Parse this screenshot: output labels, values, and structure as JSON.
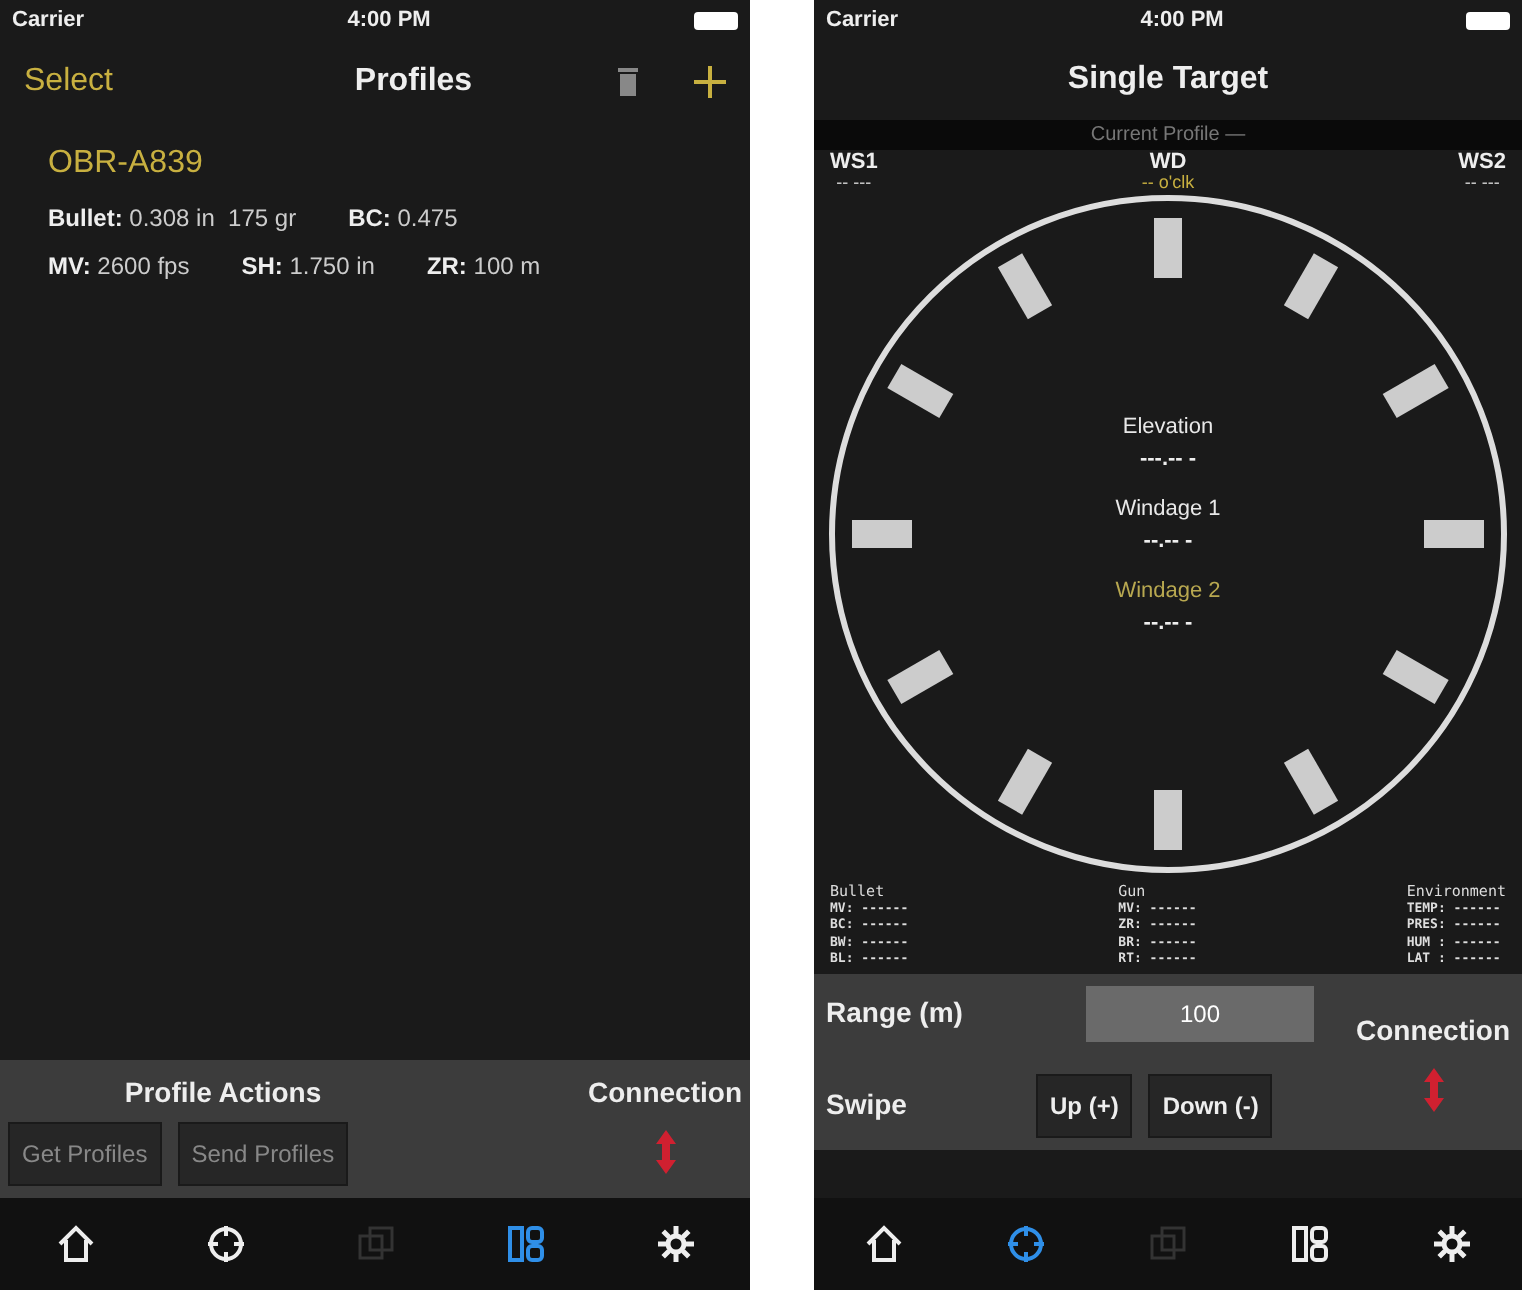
{
  "profiles_screen": {
    "status_bar": {
      "carrier": "Carrier",
      "time": "4:00 PM"
    },
    "nav": {
      "left": "Select",
      "title": "Profiles"
    },
    "profiles": [
      {
        "name": "OBR-A839",
        "rows": [
          [
            {
              "label": "Bullet:",
              "value": "0.308 in  175 gr"
            },
            {
              "label": "BC:",
              "value": "0.475"
            }
          ],
          [
            {
              "label": "MV:",
              "value": "2600 fps"
            },
            {
              "label": "SH:",
              "value": "1.750 in"
            },
            {
              "label": "ZR:",
              "value": "100 m"
            }
          ]
        ]
      }
    ],
    "actions_title": "Profile Actions",
    "connection_label": "Connection",
    "buttons": [
      {
        "label": "Get Profiles",
        "disabled": true
      },
      {
        "label": "Send Profiles",
        "disabled": true
      }
    ],
    "tabs": [
      {
        "kind": "home",
        "selected": false,
        "disabled": false
      },
      {
        "kind": "target",
        "selected": false,
        "disabled": false
      },
      {
        "kind": "window",
        "selected": false,
        "disabled": true
      },
      {
        "kind": "grid",
        "selected": true,
        "disabled": false
      },
      {
        "kind": "gear",
        "selected": false,
        "disabled": false
      }
    ]
  },
  "single_target_screen": {
    "status_bar": {
      "carrier": "Carrier",
      "time": "4:00 PM"
    },
    "title": "Single Target",
    "current_profile": "Current Profile —",
    "winds": [
      {
        "label": "WS1",
        "value": "-- ---",
        "color": "#d0d0d0"
      },
      {
        "label": "WD",
        "value": "-- o'clk",
        "color": "#c8b040"
      },
      {
        "label": "WS2",
        "value": "-- ---",
        "color": "#d0d0d0"
      }
    ],
    "readouts": [
      {
        "label": "Elevation",
        "value": "---.-- -",
        "color": "#e8e8e8"
      },
      {
        "label": "Windage 1",
        "value": "--.-- -",
        "color": "#e8e8e8"
      },
      {
        "label": "Windage 2",
        "value": "--.-- -",
        "color": "#b8a850"
      }
    ],
    "data_groups": [
      {
        "title": "Bullet",
        "rows": [
          "MV: ------",
          "BC: ------",
          "BW: ------",
          "BL: ------"
        ]
      },
      {
        "title": "Gun",
        "rows": [
          "MV: ------",
          "ZR: ------",
          "BR: ------",
          "RT: ------"
        ]
      },
      {
        "title": "Environment",
        "rows": [
          "TEMP: ------",
          "PRES: ------",
          "HUM : ------",
          "LAT : ------"
        ]
      }
    ],
    "range": {
      "label": "Range (m)",
      "value": "100"
    },
    "connection_label": "Connection",
    "swipe": {
      "label": "Swipe",
      "buttons": [
        "Up (+)",
        "Down (-)"
      ]
    },
    "tabs": [
      {
        "kind": "home",
        "selected": false,
        "disabled": false
      },
      {
        "kind": "target",
        "selected": true,
        "disabled": false
      },
      {
        "kind": "window",
        "selected": false,
        "disabled": true
      },
      {
        "kind": "grid",
        "selected": false,
        "disabled": false
      },
      {
        "kind": "gear",
        "selected": false,
        "disabled": false
      }
    ]
  }
}
